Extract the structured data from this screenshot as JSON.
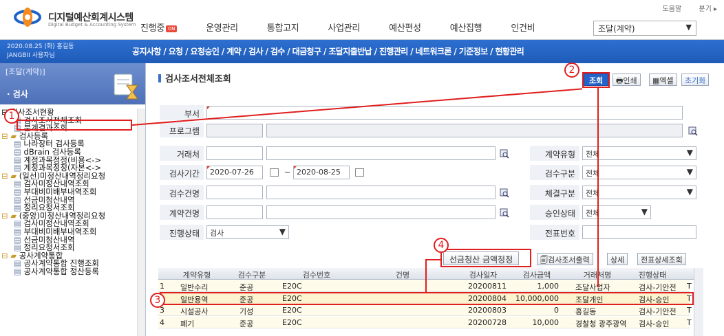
{
  "header": {
    "logo_title": "디지털예산회계시스템",
    "logo_sub": "Digital Budget & Accounting System",
    "util_links": [
      "도움말",
      "분기 ▸"
    ],
    "nav_items": [
      "진행중",
      "운영관리",
      "통합고지",
      "사업관리",
      "예산편성",
      "예산집행",
      "인건비"
    ],
    "nav_badge": "ON",
    "nav_select": "조달(계약)"
  },
  "userbar": {
    "date_line": "2020.08.25 (화) 홍길동",
    "user_line": "JANGBII 사용자님",
    "submenu": "공지사항 / 요청 / 요청승인 / 계약 / 검사 / 검수 / 대금청구 / 조달지출반납 / 진행관리 / 네트워크론 / 기준정보 / 현황관리"
  },
  "sidebar": {
    "category": "[조달(계약)]",
    "section": "· 검사",
    "tree": [
      {
        "level": 0,
        "icon": "minus",
        "label": "검사조서현황"
      },
      {
        "level": 1,
        "icon": "doc",
        "label": "검사조서전체조회"
      },
      {
        "level": 1,
        "icon": "doc",
        "label": "분계결과조회"
      },
      {
        "level": 0,
        "icon": "folder",
        "label": "검사등록"
      },
      {
        "level": 1,
        "icon": "doc",
        "label": "나라장터 검사등록"
      },
      {
        "level": 1,
        "icon": "doc",
        "label": "dBrain 검사등록"
      },
      {
        "level": 1,
        "icon": "doc",
        "label": "계정과목정정(비용<->"
      },
      {
        "level": 1,
        "icon": "doc",
        "label": "계정과목정정(자본<->"
      },
      {
        "level": 0,
        "icon": "folder",
        "label": "(일선)미정산내역정리요청"
      },
      {
        "level": 1,
        "icon": "doc",
        "label": "검사미정산내역조회"
      },
      {
        "level": 1,
        "icon": "doc",
        "label": "부대비미배부내역조회"
      },
      {
        "level": 1,
        "icon": "doc",
        "label": "선금미청산내역"
      },
      {
        "level": 1,
        "icon": "doc",
        "label": "정리요청서조회"
      },
      {
        "level": 0,
        "icon": "folder",
        "label": "(중앙)미정산내역정리요청"
      },
      {
        "level": 1,
        "icon": "doc",
        "label": "검사미정산내역조회"
      },
      {
        "level": 1,
        "icon": "doc",
        "label": "부대비미배부내역조회"
      },
      {
        "level": 1,
        "icon": "doc",
        "label": "선금미청산내역"
      },
      {
        "level": 1,
        "icon": "doc",
        "label": "정리요청서조회"
      },
      {
        "level": 0,
        "icon": "folder",
        "label": "공사계약통합"
      },
      {
        "level": 1,
        "icon": "doc",
        "label": "공사계약통합 진행조회"
      },
      {
        "level": 1,
        "icon": "doc",
        "label": "공사계약통합 정산등록"
      }
    ]
  },
  "page": {
    "title": "검사조서전체조회",
    "buttons": {
      "search": "조회",
      "print": "인쇄",
      "excel": "엑셀",
      "reset": "초기화"
    }
  },
  "form": {
    "dept_label": "부서",
    "program_label": "프로그램",
    "vendor_label": "거래처",
    "contract_type_label": "계약유형",
    "contract_type_value": "전체",
    "period_label": "검사기간",
    "period_from": "2020-07-26",
    "period_sep": "~",
    "period_to": "2020-08-25",
    "acceptance_type_label": "검수구분",
    "acceptance_type_value": "전체",
    "acceptance_name_label": "검수건명",
    "conclusion_type_label": "체결구분",
    "conclusion_type_value": "전체",
    "contract_name_label": "계약건명",
    "approval_label": "승인상태",
    "approval_value": "전체",
    "progress_label": "진행상태",
    "progress_value": "검사",
    "voucher_label": "전표번호"
  },
  "grid_buttons": {
    "advance_settle": "선금청산 금액정정",
    "inspect_print": "검사조서출력",
    "detail": "상세",
    "voucher_detail": "전표상세조회"
  },
  "grid": {
    "columns": [
      "계약유형",
      "검수구분",
      "검수번호",
      "건명",
      "검사일자",
      "검사금액",
      "거래처명",
      "진행상태"
    ],
    "rows": [
      {
        "no": "1",
        "type": "일반수리",
        "kind": "준공",
        "code": "E20C",
        "date": "20200811",
        "amount": "1,000",
        "vendor": "조달사업자",
        "status": "검사-기안전",
        "extra": "T"
      },
      {
        "no": "2",
        "type": "일반용역",
        "kind": "준공",
        "code": "E20C",
        "date": "20200804",
        "amount": "10,000,000",
        "vendor": "조달개인",
        "status": "검사-승인",
        "extra": "T"
      },
      {
        "no": "3",
        "type": "시설공사",
        "kind": "기성",
        "code": "E20C",
        "date": "20200803",
        "amount": "0",
        "vendor": "홍길동",
        "status": "검사-기안전",
        "extra": "T"
      },
      {
        "no": "4",
        "type": "폐기",
        "kind": "준공",
        "code": "E20C",
        "date": "20200728",
        "amount": "10,000",
        "vendor": "경찰청 광주광역",
        "status": "검사-승인",
        "extra": "T"
      }
    ]
  },
  "callouts": [
    "1",
    "2",
    "3",
    "4"
  ],
  "colors": {
    "accent": "#2563c8",
    "callout": "#e01e1e",
    "header_blue": "#1f5bb8"
  }
}
